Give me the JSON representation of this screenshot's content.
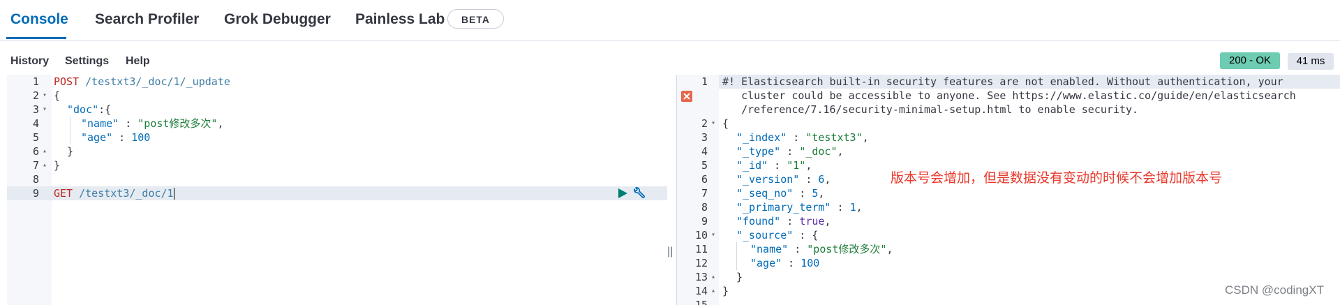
{
  "tabs": {
    "console": "Console",
    "search_profiler": "Search Profiler",
    "grok_debugger": "Grok Debugger",
    "painless_lab": "Painless Lab",
    "beta": "BETA"
  },
  "toolbar": {
    "history": "History",
    "settings": "Settings",
    "help": "Help",
    "status": "200 - OK",
    "time": "41 ms"
  },
  "request": {
    "line_numbers": [
      "1",
      "2",
      "3",
      "4",
      "5",
      "6",
      "7",
      "8",
      "9"
    ],
    "lines": {
      "l1_method": "POST",
      "l1_url": " /testxt3/_doc/1/_update",
      "l2": "{",
      "l3_key": "\"doc\"",
      "l3_rest": ":{",
      "l4_key": "\"name\"",
      "l4_sep": " : ",
      "l4_val": "\"post修改多次\"",
      "l4_end": ",",
      "l5_key": "\"age\"",
      "l5_sep": " : ",
      "l5_val": "100",
      "l6": "}",
      "l7": "}",
      "l9_method": "GET",
      "l9_url": " /testxt3/_doc/1"
    }
  },
  "response": {
    "line_numbers": [
      "1",
      "2",
      "3",
      "4",
      "5",
      "6",
      "7",
      "8",
      "9",
      "10",
      "11",
      "12",
      "13",
      "14",
      "15"
    ],
    "warning_l1": "#! Elasticsearch built-in security features are not enabled. Without authentication, your",
    "warning_l2": "   cluster could be accessible to anyone. See https://www.elastic.co/guide/en/elasticsearch",
    "warning_l3": "   /reference/7.16/security-minimal-setup.html to enable security.",
    "open": "{",
    "index_key": "\"_index\"",
    "index_val": "\"testxt3\"",
    "type_key": "\"_type\"",
    "type_val": "\"_doc\"",
    "id_key": "\"_id\"",
    "id_val": "\"1\"",
    "version_key": "\"_version\"",
    "version_val": "6",
    "seq_key": "\"_seq_no\"",
    "seq_val": "5",
    "term_key": "\"_primary_term\"",
    "term_val": "1",
    "found_key": "\"found\"",
    "found_val": "true",
    "source_key": "\"_source\"",
    "source_open": "{",
    "name_key": "\"name\"",
    "name_val": "\"post修改多次\"",
    "age_key": "\"age\"",
    "age_val": "100",
    "source_close": "}",
    "close": "}"
  },
  "annotation": "版本号会增加，但是数据没有变动的时候不会增加版本号",
  "watermark": "CSDN @codingXT",
  "splitter": "||",
  "colors": {
    "accent": "#006bb8",
    "ok": "#6dccb1",
    "error": "#e7664c",
    "annotation": "#e8382b"
  }
}
